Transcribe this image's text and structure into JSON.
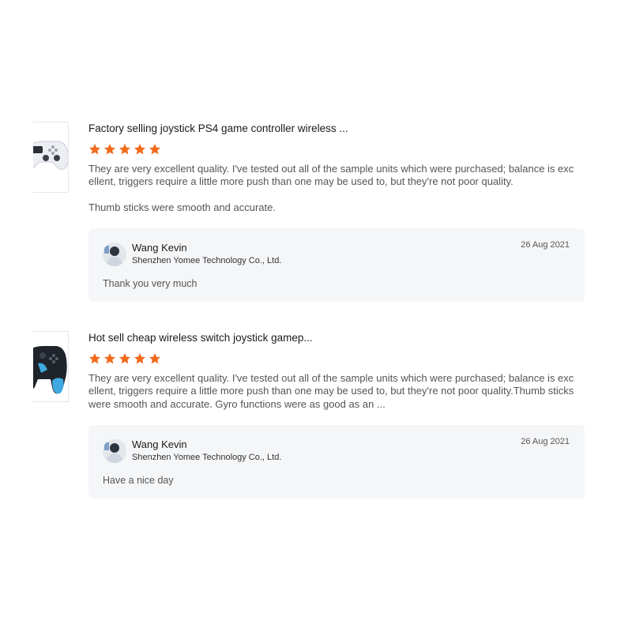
{
  "colors": {
    "star": "#f26a1b",
    "reply_bg": "#f5f6f8"
  },
  "reviews": [
    {
      "product_title": "Factory selling joystick PS4 game controller wireless ...",
      "rating": 5,
      "body": [
        "They are very excellent quality. I've tested out all of the sample units which were purchased; balance is exc",
        "ellent, triggers require a little more push than one may be used to, but they're not poor quality.",
        "Thumb sticks were smooth and accurate."
      ],
      "reply": {
        "name": "Wang Kevin",
        "company": "Shenzhen Yomee Technology Co., Ltd.",
        "date": "26 Aug 2021",
        "text": "Thank you very much"
      }
    },
    {
      "product_title": "Hot sell cheap wireless switch joystick gamep...",
      "rating": 5,
      "body": [
        "They are very excellent quality. I've tested out all of the sample units which were purchased; balance is exc",
        "ellent, triggers require a little more push than one may be used to, but they're not poor quality.Thumb sticks",
        "were smooth and accurate. Gyro functions were as good as an ..."
      ],
      "reply": {
        "name": "Wang Kevin",
        "company": "Shenzhen Yomee Technology Co., Ltd.",
        "date": "26 Aug 2021",
        "text": "Have a nice day"
      }
    }
  ]
}
